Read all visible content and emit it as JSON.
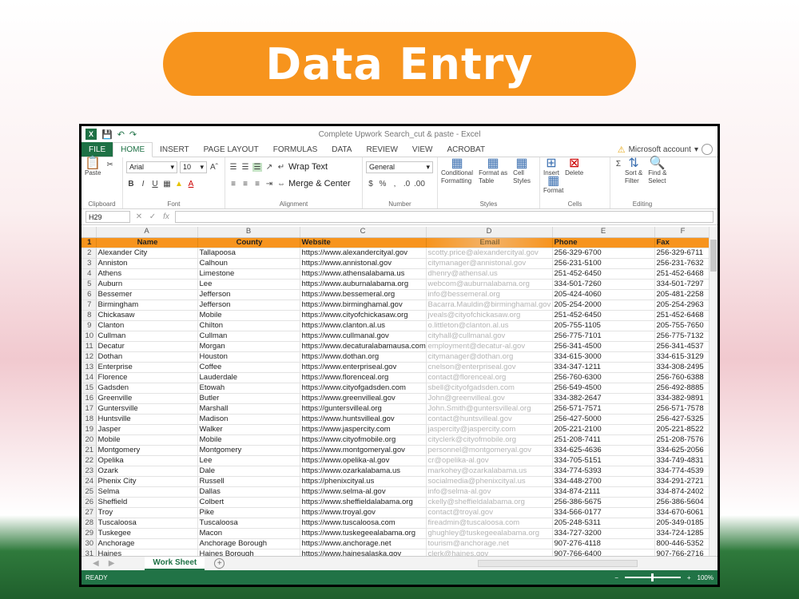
{
  "banner": {
    "title": "Data Entry"
  },
  "window": {
    "title": "Complete Upwork Search_cut & paste - Excel"
  },
  "tabs": [
    "FILE",
    "HOME",
    "INSERT",
    "PAGE LAYOUT",
    "FORMULAS",
    "DATA",
    "REVIEW",
    "VIEW",
    "ACROBAT"
  ],
  "account": "Microsoft account",
  "ribbon": {
    "clipboard": {
      "paste": "Paste",
      "label": "Clipboard"
    },
    "font": {
      "name": "Arial",
      "size": "10",
      "label": "Font"
    },
    "alignment": {
      "wrap": "Wrap Text",
      "merge": "Merge & Center",
      "label": "Alignment"
    },
    "number": {
      "format": "General",
      "label": "Number"
    },
    "styles": {
      "conditional": "Conditional\nFormatting",
      "format_table": "Format as\nTable",
      "cell_styles": "Cell\nStyles",
      "label": "Styles"
    },
    "cells": {
      "insert": "Insert",
      "delete": "Delete",
      "format": "Format",
      "label": "Cells"
    },
    "editing": {
      "sort": "Sort &\nFilter",
      "find": "Find &\nSelect",
      "label": "Editing"
    }
  },
  "formula_bar": {
    "name_box": "H29",
    "formula": ""
  },
  "columns": [
    "A",
    "B",
    "C",
    "D",
    "E",
    "F"
  ],
  "headers": [
    "Name",
    "County",
    "Website",
    "Email",
    "Phone",
    "Fax"
  ],
  "rows": [
    [
      "Alexander City",
      "Tallapoosa",
      "https://www.alexandercityal.gov",
      "scotty.price@alexandercityal.gov",
      "256-329-6700",
      "256-329-6711"
    ],
    [
      "Anniston",
      "Calhoun",
      "https://www.annistonal.gov",
      "citymanager@annistonal.gov",
      "256-231-5100",
      "256-231-7632"
    ],
    [
      "Athens",
      "Limestone",
      "https://www.athensalabama.us",
      "dhenry@athensal.us",
      "251-452-6450",
      "251-452-6468"
    ],
    [
      "Auburn",
      "Lee",
      "https://www.auburnalabama.org",
      "webcom@auburnalabama.org",
      "334-501-7260",
      "334-501-7297"
    ],
    [
      "Bessemer",
      "Jefferson",
      "https://www.bessemeral.org",
      "info@bessemeral.org",
      "205-424-4060",
      "205-481-2258"
    ],
    [
      "Birmingham",
      "Jefferson",
      "https://www.birminghamal.gov",
      "Bacarra.Mauldin@birminghamal.gov",
      "205-254-2000",
      "205-254-2963"
    ],
    [
      "Chickasaw",
      "Mobile",
      "https://www.cityofchickasaw.org",
      "jveals@cityofchickasaw.org",
      "251-452-6450",
      "251-452-6468"
    ],
    [
      "Clanton",
      "Chilton",
      "https://www.clanton.al.us",
      "o.littleton@clanton.al.us",
      "205-755-1105",
      "205-755-7650"
    ],
    [
      "Cullman",
      "Cullman",
      "https://www.cullmanal.gov",
      "cityhall@cullmanal.gov",
      "256-775-7101",
      "256-775-7132"
    ],
    [
      "Decatur",
      "Morgan",
      "https://www.decaturalabamausa.com",
      "employment@decatur-al.gov",
      "256-341-4500",
      "256-341-4537"
    ],
    [
      "Dothan",
      "Houston",
      "https://www.dothan.org",
      "citymanager@dothan.org",
      "334-615-3000",
      "334-615-3129"
    ],
    [
      "Enterprise",
      "Coffee",
      "https://www.enterpriseal.gov",
      "cnelson@enterpriseal.gov",
      "334-347-1211",
      "334-308-2495"
    ],
    [
      "Florence",
      "Lauderdale",
      "https://www.florenceal.org",
      "contact@florenceal.org",
      "256-760-6300",
      "256-760-6388"
    ],
    [
      "Gadsden",
      "Etowah",
      "https://www.cityofgadsden.com",
      "sbell@cityofgadsden.com",
      "256-549-4500",
      "256-492-8885"
    ],
    [
      "Greenville",
      "Butler",
      "https://www.greenvilleal.gov",
      "John@greenvilleal.gov",
      "334-382-2647",
      "334-382-9891"
    ],
    [
      "Guntersville",
      "Marshall",
      "https://guntersvilleal.org",
      "John.Smith@guntersvilleal.org",
      "256-571-7571",
      "256-571-7578"
    ],
    [
      "Huntsville",
      "Madison",
      "https://www.huntsvilleal.gov",
      "contact@huntsvilleal.gov",
      "256-427-5000",
      "256-427-5325"
    ],
    [
      "Jasper",
      "Walker",
      "https://www.jaspercity.com",
      "jaspercity@jaspercity.com",
      "205-221-2100",
      "205-221-8522"
    ],
    [
      "Mobile",
      "Mobile",
      "https://www.cityofmobile.org",
      "cityclerk@cityofmobile.org",
      "251-208-7411",
      "251-208-7576"
    ],
    [
      "Montgomery",
      "Montgomery",
      "https://www.montgomeryal.gov",
      "personnel@montgomeryal.gov",
      "334-625-4636",
      "334-625-2056"
    ],
    [
      "Opelika",
      "Lee",
      "https://www.opelika-al.gov",
      "cr@opelika-al.gov",
      "334-705-5151",
      "334-749-4831"
    ],
    [
      "Ozark",
      "Dale",
      "https://www.ozarkalabama.us",
      "markohey@ozarkalabama.us",
      "334-774-5393",
      "334-774-4539"
    ],
    [
      "Phenix City",
      "Russell",
      "https://phenixcityal.us",
      "socialmedia@phenixcityal.us",
      "334-448-2700",
      "334-291-2721"
    ],
    [
      "Selma",
      "Dallas",
      "https://www.selma-al.gov",
      "info@selma-al.gov",
      "334-874-2111",
      "334-874-2402"
    ],
    [
      "Sheffield",
      "Colbert",
      "https://www.sheffieldalabama.org",
      "ckelly@sheffieldalabama.org",
      "256-386-5675",
      "256-386-5604"
    ],
    [
      "Troy",
      "Pike",
      "https://www.troyal.gov",
      "contact@troyal.gov",
      "334-566-0177",
      "334-670-6061"
    ],
    [
      "Tuscaloosa",
      "Tuscaloosa",
      "https://www.tuscaloosa.com",
      "fireadmin@tuscaloosa.com",
      "205-248-5311",
      "205-349-0185"
    ],
    [
      "Tuskegee",
      "Macon",
      "https://www.tuskegeealabama.org",
      "ghughley@tuskegeealabama.org",
      "334-727-3200",
      "334-724-1285"
    ],
    [
      "Anchorage",
      "Anchorage Borough",
      "https://www.anchorage.net",
      "tourism@anchorage.net",
      "907-276-4118",
      "800-446-5352"
    ],
    [
      "Haines",
      "Haines Borough",
      "https://www.hainesalaska.gov",
      "clerk@haines.gov",
      "907-766-6400",
      "907-766-2716"
    ]
  ],
  "sheet_tab": "Work Sheet",
  "status": {
    "ready": "READY",
    "zoom": "100%"
  }
}
